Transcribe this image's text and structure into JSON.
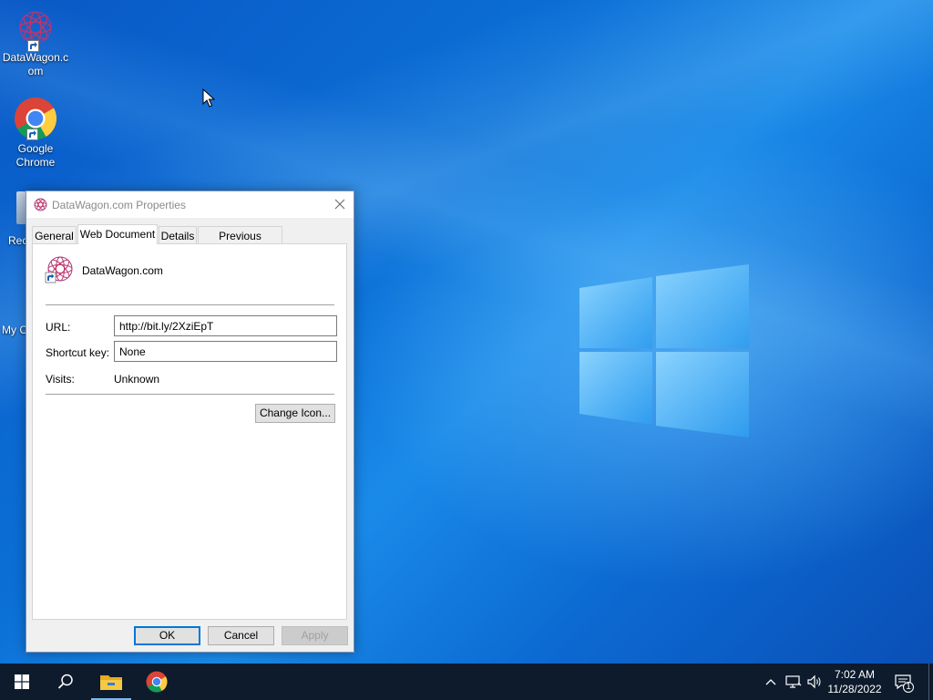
{
  "desktop": {
    "icons": [
      {
        "label": "DataWagon.com"
      },
      {
        "label": "Google Chrome"
      }
    ],
    "partial_labels": [
      "Rec",
      "My C"
    ]
  },
  "dialog": {
    "title": "DataWagon.com Properties",
    "tabs": [
      {
        "label": "General"
      },
      {
        "label": "Web Document"
      },
      {
        "label": "Details"
      },
      {
        "label": "Previous Versions"
      }
    ],
    "active_tab": "Web Document",
    "document_name": "DataWagon.com",
    "url_label": "URL:",
    "url_value": "http://bit.ly/2XziEpT",
    "shortcut_label": "Shortcut key:",
    "shortcut_value": "None",
    "visits_label": "Visits:",
    "visits_value": "Unknown",
    "change_icon_label": "Change Icon...",
    "ok_label": "OK",
    "cancel_label": "Cancel",
    "apply_label": "Apply"
  },
  "taskbar": {
    "time": "7:02 AM",
    "date": "11/28/2022",
    "notification_count": "1",
    "accent_color": "#0d1b2c"
  },
  "icons": {
    "start": "windows-start-icon",
    "search": "search-icon",
    "explorer": "file-explorer-icon",
    "chrome": "chrome-icon",
    "network": "network-icon",
    "volume": "volume-icon",
    "notifications": "action-center-icon"
  }
}
